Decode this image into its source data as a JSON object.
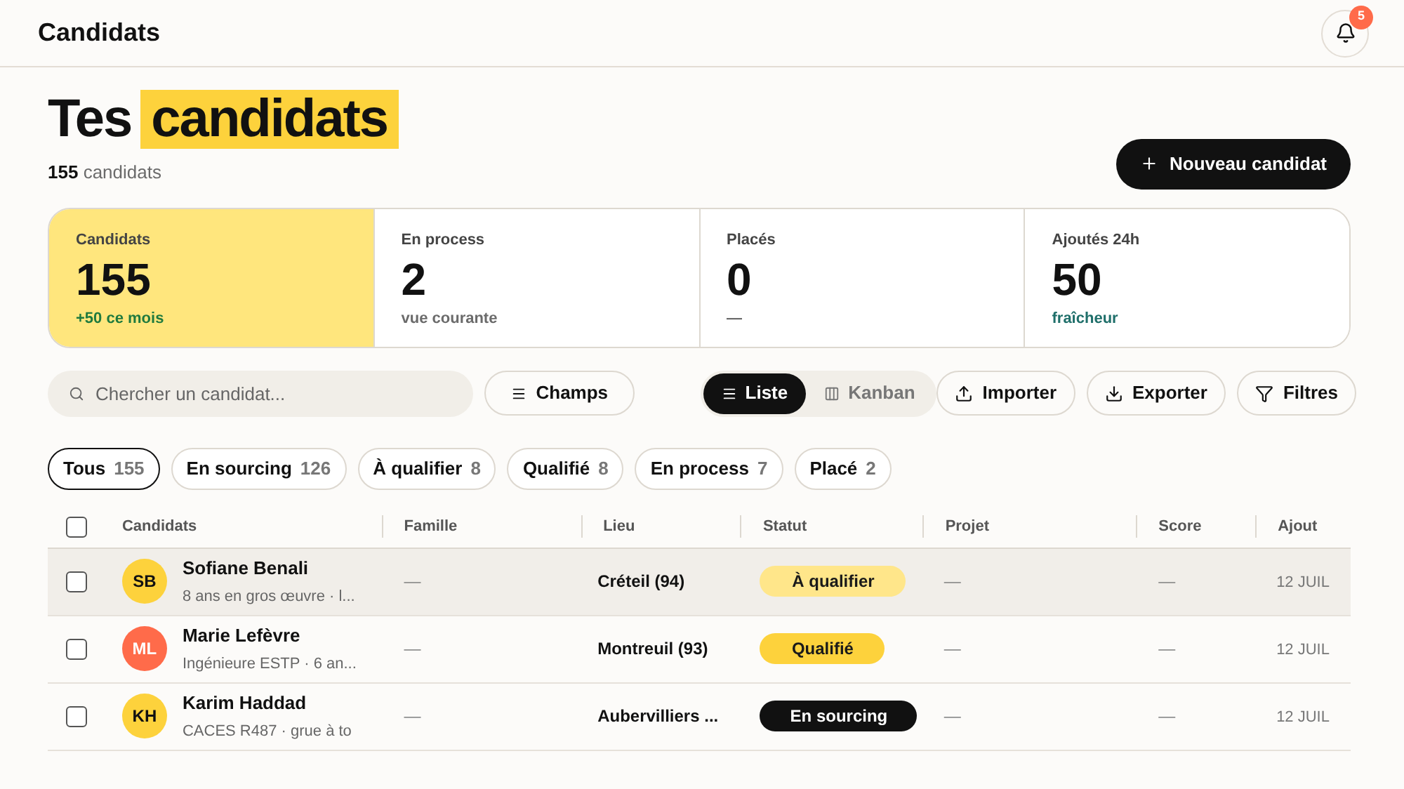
{
  "header": {
    "title": "Candidats",
    "notifications": "5"
  },
  "page": {
    "title_plain": "Tes",
    "title_highlight": "candidats",
    "count": "155",
    "count_label": "candidats",
    "new_button": "Nouveau candidat"
  },
  "stats": [
    {
      "label": "Candidats",
      "value": "155",
      "note": "+50 ce mois",
      "selected": true,
      "kind": "positive"
    },
    {
      "label": "En process",
      "value": "2",
      "note": "vue courante",
      "selected": false,
      "kind": "muted"
    },
    {
      "label": "Placés",
      "value": "0",
      "note": "—",
      "selected": false,
      "kind": "muted"
    },
    {
      "label": "Ajoutés 24h",
      "value": "50",
      "note": "fraîcheur",
      "selected": false,
      "kind": "accent"
    }
  ],
  "toolbar": {
    "search_placeholder": "Chercher un candidat...",
    "fields_button": "Champs",
    "views": [
      {
        "label": "Liste",
        "selected": true,
        "kind": "list"
      },
      {
        "label": "Kanban",
        "selected": false,
        "kind": "kanban"
      }
    ],
    "actions": [
      {
        "label": "Importer",
        "kind": "import"
      },
      {
        "label": "Exporter",
        "kind": "export"
      },
      {
        "label": "Filtres",
        "kind": "filter"
      }
    ]
  },
  "filters": [
    {
      "label": "Tous",
      "count": "155",
      "selected": true
    },
    {
      "label": "En sourcing",
      "count": "126",
      "selected": false
    },
    {
      "label": "À qualifier",
      "count": "8",
      "selected": false
    },
    {
      "label": "Qualifié",
      "count": "8",
      "selected": false
    },
    {
      "label": "En process",
      "count": "7",
      "selected": false
    },
    {
      "label": "Placé",
      "count": "2",
      "selected": false
    }
  ],
  "table": {
    "select_all_checked": false,
    "columns": [
      "Candidats",
      "Famille",
      "Lieu",
      "Statut",
      "Projet",
      "Score",
      "Ajout"
    ],
    "rows": [
      {
        "initials": "SB",
        "color": "#fdd23c",
        "name": "Sofiane Benali",
        "subtitle": "8 ans en gros œuvre · l...",
        "family": "—",
        "location": "Créteil (94)",
        "status": {
          "label": "À qualifier",
          "kind": "to_qualify"
        },
        "project": "—",
        "score": "—",
        "added": "12 JUIL",
        "checked": false,
        "highlighted": true
      },
      {
        "initials": "ML",
        "color": "#ff6b4a",
        "name": "Marie Lefèvre",
        "subtitle": "Ingénieure ESTP · 6 an...",
        "family": "—",
        "location": "Montreuil (93)",
        "status": {
          "label": "Qualifié",
          "kind": "qualified"
        },
        "project": "—",
        "score": "—",
        "added": "12 JUIL",
        "checked": false,
        "highlighted": false
      },
      {
        "initials": "KH",
        "color": "#fdd23c",
        "name": "Karim Haddad",
        "subtitle": "CACES R487 · grue à to",
        "family": "—",
        "location": "Aubervilliers ...",
        "status": {
          "label": "En sourcing",
          "kind": "sourcing"
        },
        "project": "—",
        "score": "—",
        "added": "12 JUIL",
        "checked": false,
        "highlighted": false
      }
    ]
  }
}
